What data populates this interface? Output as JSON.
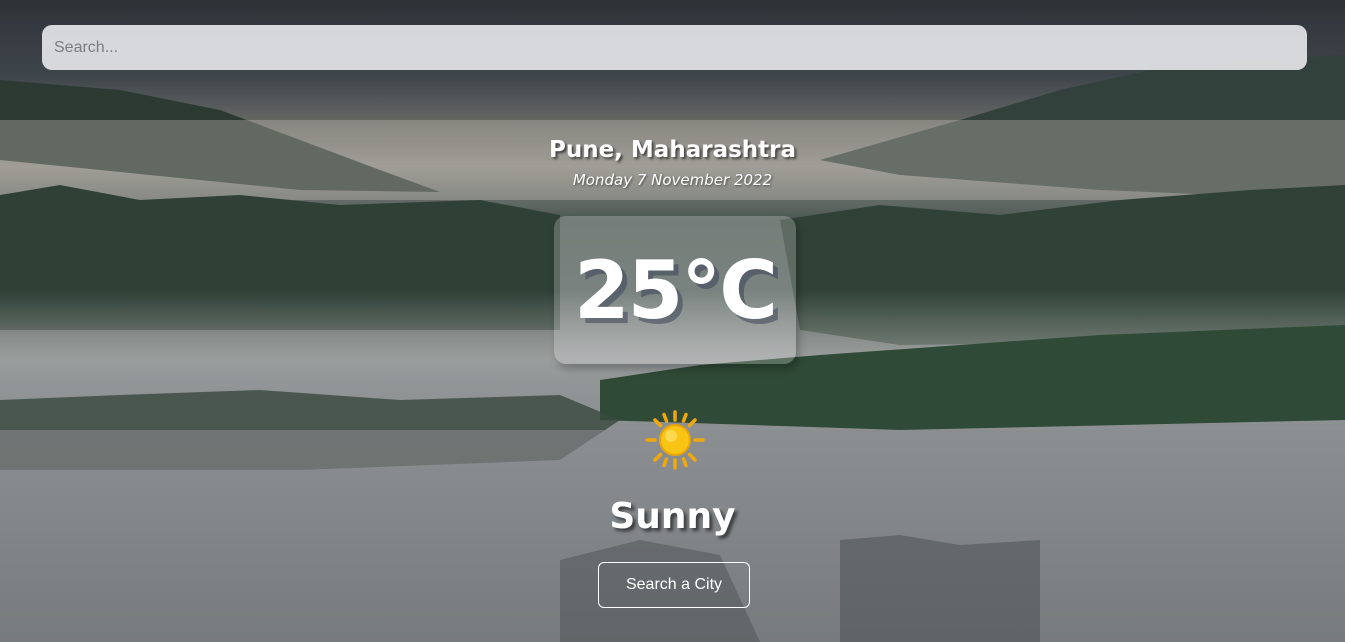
{
  "search": {
    "placeholder": "Search..."
  },
  "location": {
    "city": "Pune, Maharashtra",
    "date": "Monday 7 November 2022"
  },
  "weather": {
    "temperature": "25°C",
    "condition": "Sunny",
    "icon": "sun-icon"
  },
  "actions": {
    "search_city_label": "Search a City"
  },
  "colors": {
    "text": "#ffffff",
    "sun": "#f9c413",
    "search_bg": "#e4e5e8"
  }
}
